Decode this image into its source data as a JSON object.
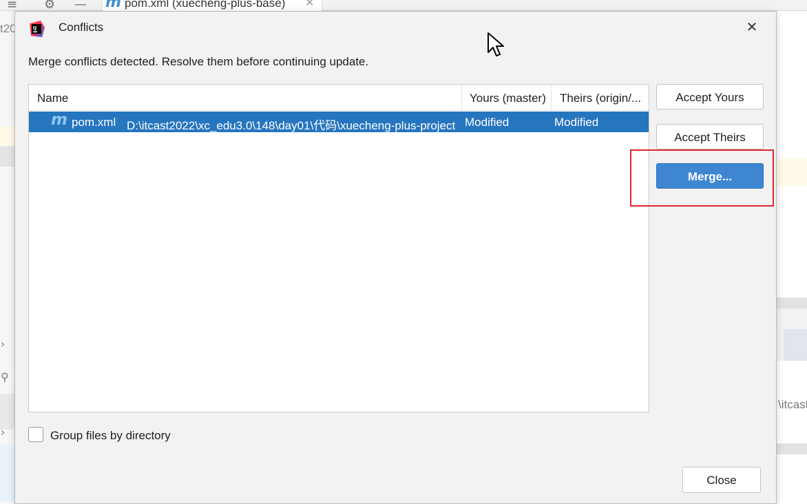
{
  "ide": {
    "tab_title": "pom.xml (xuecheng-plus-base)",
    "tab_icon": "maven-file-icon",
    "left_fragment": "t20",
    "right_fragment": "\\itcast"
  },
  "dialog": {
    "title": "Conflicts",
    "message": "Merge conflicts detected. Resolve them before continuing update.",
    "table": {
      "headers": [
        "Name",
        "Yours (master)",
        "Theirs (origin/..."
      ],
      "rows": [
        {
          "icon": "maven-file-icon",
          "name": "pom.xml",
          "path": "D:\\itcast2022\\xc_edu3.0\\148\\day01\\代码\\xuecheng-plus-project",
          "yours": "Modified",
          "theirs": "Modified",
          "selected": true
        }
      ]
    },
    "buttons": {
      "accept_yours": "Accept Yours",
      "accept_theirs": "Accept Theirs",
      "merge": "Merge...",
      "close": "Close"
    },
    "group_by_directory": {
      "label": "Group files by directory",
      "checked": false
    }
  },
  "colors": {
    "selection": "#2675bf",
    "primary_button": "#3f86d2",
    "highlight_box": "#e0262b",
    "dialog_bg": "#f2f2f2"
  }
}
